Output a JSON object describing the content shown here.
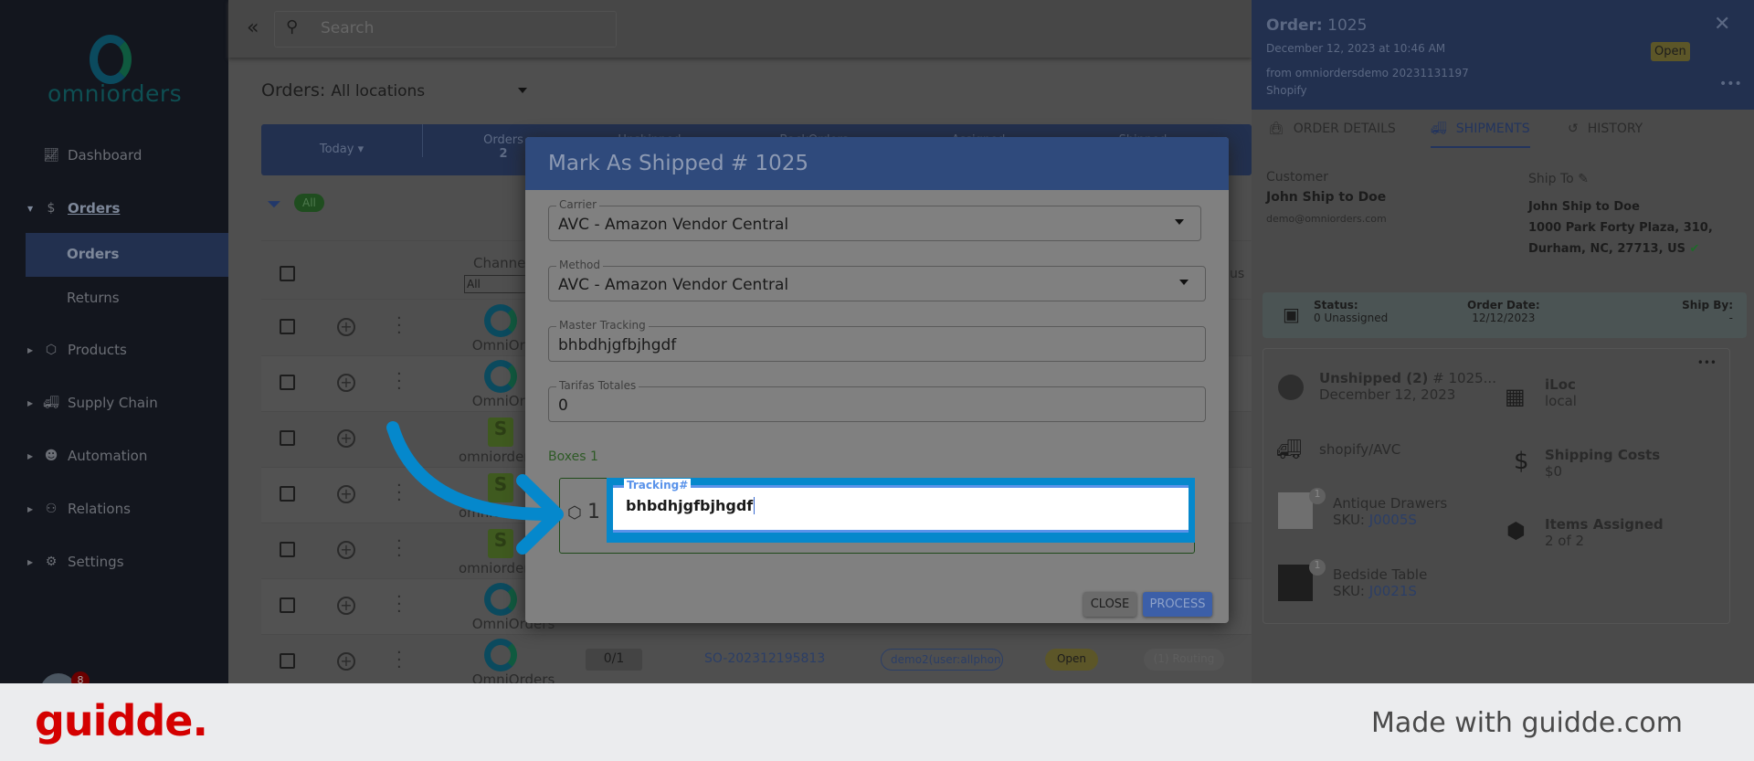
{
  "sidebar": {
    "logo": "omniorders",
    "items": [
      {
        "label": "Dashboard"
      },
      {
        "label": "Orders"
      },
      {
        "label": "Products"
      },
      {
        "label": "Supply Chain"
      },
      {
        "label": "Automation"
      },
      {
        "label": "Relations"
      },
      {
        "label": "Settings"
      }
    ],
    "sub_items": [
      {
        "label": "Orders"
      },
      {
        "label": "Returns"
      }
    ],
    "notification_count": "8"
  },
  "topbar": {
    "search_placeholder": "Search"
  },
  "orders": {
    "title": "Orders:",
    "location": "All locations",
    "filter_chip": "All",
    "stats": [
      {
        "label": "Today"
      },
      {
        "label": "Orders",
        "value": "2"
      },
      {
        "label": "Unshipped"
      },
      {
        "label": "BackOrders"
      },
      {
        "label": "Assigned"
      },
      {
        "label": "Shipped"
      }
    ],
    "columns": {
      "channel": "Channel",
      "channel_filter": "All",
      "status": "us"
    },
    "rows": [
      {
        "channel": "OmniOrders",
        "type": "omni"
      },
      {
        "channel": "OmniOrders",
        "type": "omni"
      },
      {
        "channel": "omniordersdemo",
        "type": "shopify"
      },
      {
        "channel": "omniordersdemo",
        "type": "shopify"
      },
      {
        "channel": "omniordersdemo",
        "type": "shopify"
      },
      {
        "channel": "OmniOrders",
        "type": "omni"
      },
      {
        "channel": "OmniOrders",
        "type": "omni",
        "qty": "0/1",
        "order_no": "SO-202312195813",
        "user": "demo2(user:allphon",
        "status": "Open",
        "routing": "(1) Routing"
      }
    ]
  },
  "modal": {
    "title": "Mark As Shipped # 1025",
    "carrier_label": "Carrier",
    "carrier": "AVC - Amazon Vendor Central",
    "method_label": "Method",
    "method": "AVC - Amazon Vendor Central",
    "master_tracking_label": "Master Tracking",
    "master_tracking": "bhbdhjgfbjhgdf",
    "tarifas_label": "Tarifas Totales",
    "tarifas": "0",
    "boxes_label": "Boxes 1",
    "box_number": "1",
    "tracking_label": "Tracking#",
    "tracking": "bhbdhjgfbjhgdf",
    "close": "CLOSE",
    "process": "PROCESS"
  },
  "panel": {
    "order_label": "Order:",
    "order_no": "1025",
    "date": "December 12, 2023 at 10:46 AM",
    "from": "from omniordersdemo 20231131197",
    "source": "Shopify",
    "status": "Open",
    "tabs": [
      {
        "label": "ORDER DETAILS"
      },
      {
        "label": "SHIPMENTS"
      },
      {
        "label": "HISTORY"
      }
    ],
    "customer_label": "Customer",
    "customer_name": "John Ship to Doe",
    "customer_email": "demo@omniorders.com",
    "ship_to_label": "Ship To",
    "ship_name": "John Ship to Doe",
    "ship_addr1": "1000 Park Forty Plaza, 310,",
    "ship_addr2": "Durham, NC, 27713, US",
    "status_label": "Status:",
    "status_value": "0 Unassigned",
    "order_date_label": "Order Date:",
    "order_date": "12/12/2023",
    "ship_by_label": "Ship By:",
    "ship_by": "-",
    "shipment": {
      "title": "Unshipped (2)",
      "ref": "# 1025...",
      "date": "December 12, 2023",
      "carrier": "shopify/AVC",
      "location_label": "iLoc",
      "location": "local",
      "costs_label": "Shipping Costs",
      "costs": "$0",
      "assigned_label": "Items Assigned",
      "assigned": "2 of 2",
      "items": [
        {
          "qty": "1",
          "name": "Antique Drawers",
          "sku_label": "SKU:",
          "sku": "J0005S"
        },
        {
          "qty": "1",
          "name": "Bedside Table",
          "sku_label": "SKU:",
          "sku": "J0021S"
        }
      ]
    }
  },
  "footer": {
    "brand": "guidde.",
    "tagline": "Made with guidde.com"
  },
  "colors": {
    "accent": "#0588cc",
    "brand_red": "#d40000",
    "modal_header": "#2f4a7c"
  }
}
